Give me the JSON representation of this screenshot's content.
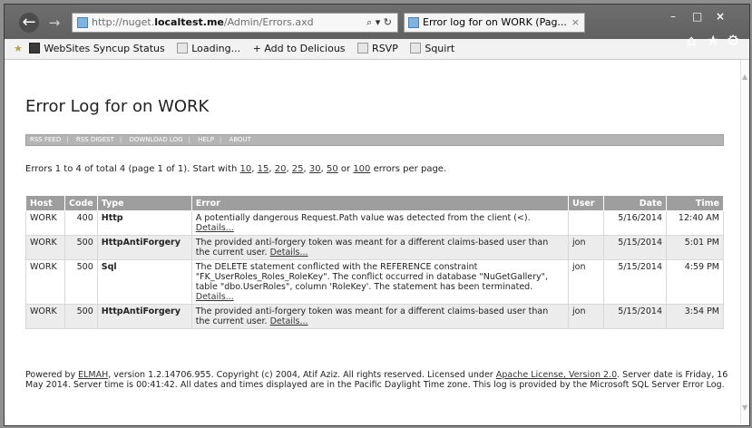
{
  "browser": {
    "address": {
      "prefix": "http://nuget.",
      "host": "localtest.me",
      "path": "/Admin/Errors.axd",
      "tools": "⌕ ▾ ↻"
    },
    "tab_title": "Error log for on WORK (Pag...",
    "tab_close": "×",
    "nav": {
      "back": "←",
      "forward": "→"
    },
    "window_controls": {
      "minimize": "–",
      "maximize": "□",
      "close": "×"
    },
    "tool_icons": {
      "home": "⌂",
      "favorites": "★",
      "settings": "⚙"
    },
    "favorites": [
      {
        "label": "WebSites Syncup Status"
      },
      {
        "label": "Loading..."
      },
      {
        "label": "+ Add to Delicious"
      },
      {
        "label": "RSVP"
      },
      {
        "label": "Squirt"
      }
    ]
  },
  "page": {
    "title": "Error Log for on WORK",
    "speedbar": [
      "RSS FEED",
      "RSS DIGEST",
      "DOWNLOAD LOG",
      "HELP",
      "ABOUT"
    ],
    "pager": {
      "prefix": "Errors 1 to 4 of total 4 (page 1 of 1). Start with ",
      "sizes": [
        "10",
        "15",
        "20",
        "25",
        "30",
        "50"
      ],
      "or": " or ",
      "last": "100",
      "suffix": " errors per page."
    },
    "columns": [
      "Host",
      "Code",
      "Type",
      "Error",
      "User",
      "Date",
      "Time"
    ],
    "rows": [
      {
        "host": "WORK",
        "code": "400",
        "type": "Http",
        "error": "A potentially dangerous Request.Path value was detected from the client (<).",
        "details": "Details...",
        "user": "",
        "date": "5/16/2014",
        "time": "12:40 AM"
      },
      {
        "host": "WORK",
        "code": "500",
        "type": "HttpAntiForgery",
        "error": "The provided anti-forgery token was meant for a different claims-based user than the current user.",
        "details": "Details...",
        "user": "jon",
        "date": "5/15/2014",
        "time": "5:01 PM"
      },
      {
        "host": "WORK",
        "code": "500",
        "type": "Sql",
        "error": "The DELETE statement conflicted with the REFERENCE constraint \"FK_UserRoles_Roles_RoleKey\". The conflict occurred in database \"NuGetGallery\", table \"dbo.UserRoles\", column 'RoleKey'. The statement has been terminated.",
        "details": "Details...",
        "user": "jon",
        "date": "5/15/2014",
        "time": "4:59 PM"
      },
      {
        "host": "WORK",
        "code": "500",
        "type": "HttpAntiForgery",
        "error": "The provided anti-forgery token was meant for a different claims-based user than the current user.",
        "details": "Details...",
        "user": "jon",
        "date": "5/15/2014",
        "time": "3:54 PM"
      }
    ],
    "footer": {
      "line1_pre": "Powered by ",
      "elmah": "ELMAH",
      "line1_mid": ", version 1.2.14706.955. Copyright (c) 2004, Atif Aziz. All rights reserved. Licensed under ",
      "license": "Apache License, Version 2.0",
      "line1_post": ".",
      "rest": " Server date is Friday, 16 May 2014. Server time is 00:41:42. All dates and times displayed are in the Pacific Daylight Time zone. This log is provided by the Microsoft SQL Server Error Log."
    }
  }
}
